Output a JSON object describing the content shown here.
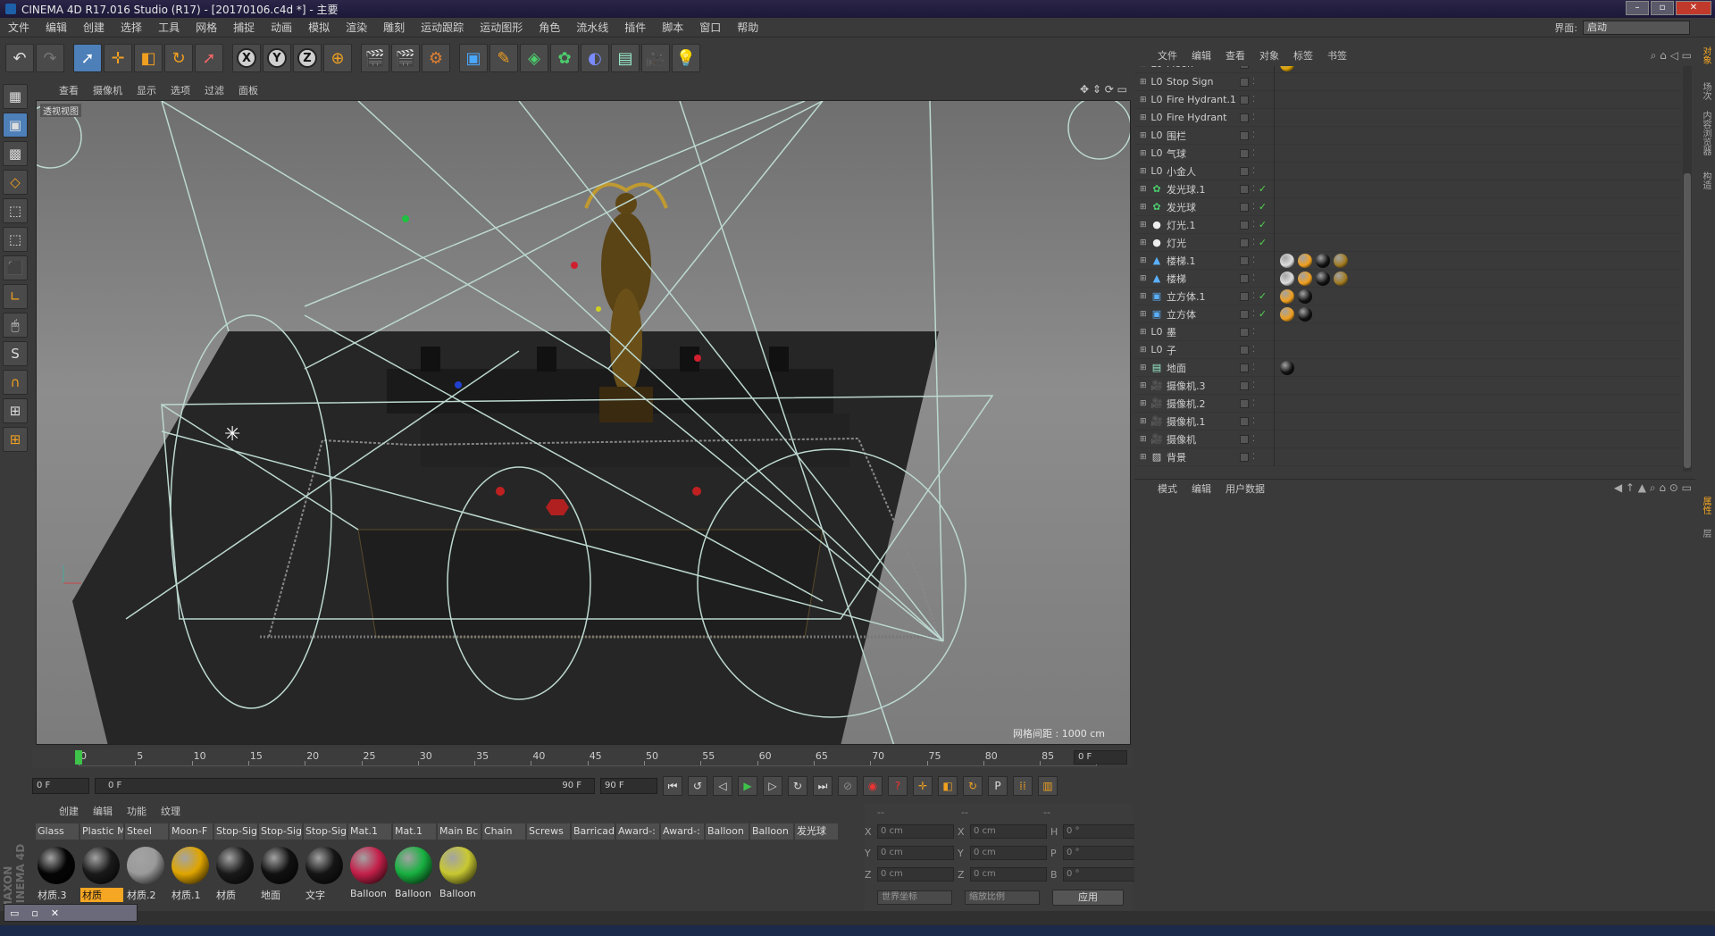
{
  "window": {
    "title": "CINEMA 4D R17.016 Studio (R17) - [20170106.c4d *] - 主要"
  },
  "menubar": [
    "文件",
    "编辑",
    "创建",
    "选择",
    "工具",
    "网格",
    "捕捉",
    "动画",
    "模拟",
    "渲染",
    "雕刻",
    "运动跟踪",
    "运动图形",
    "角色",
    "流水线",
    "插件",
    "脚本",
    "窗口",
    "帮助"
  ],
  "layout": {
    "label": "界面:",
    "value": "启动"
  },
  "toolbar": {
    "undo_icon": "undo-icon",
    "axis_x": "X",
    "axis_y": "Y",
    "axis_z": "Z"
  },
  "viewport": {
    "menu": [
      "查看",
      "摄像机",
      "显示",
      "选项",
      "过滤",
      "面板"
    ],
    "label": "透视视图",
    "grid_readout": "网格间距 : 1000 cm"
  },
  "timeline": {
    "ticks": [
      "0",
      "5",
      "10",
      "15",
      "20",
      "25",
      "30",
      "35",
      "40",
      "45",
      "50",
      "55",
      "60",
      "65",
      "70",
      "75",
      "80",
      "85",
      "90"
    ],
    "current_frame": "0 F",
    "start_field": "0 F",
    "range_start": "0 F",
    "range_end": "90 F",
    "end_field": "90 F"
  },
  "materials": {
    "menu": [
      "创建",
      "编辑",
      "功能",
      "纹理"
    ],
    "items": [
      {
        "name": "Glass",
        "label": "材质.3",
        "color": "#050505",
        "highlight": false
      },
      {
        "name": "Plastic M",
        "label": "材质",
        "color": "#1a1a1a",
        "highlight": true
      },
      {
        "name": "Steel",
        "label": "材质.2",
        "color": "#9a9a9a",
        "highlight": false
      },
      {
        "name": "Moon-F",
        "label": "材质.1",
        "color": "#e0a500",
        "highlight": false
      },
      {
        "name": "Stop-Sig",
        "label": "材质",
        "color": "#1a1a1a",
        "highlight": false
      },
      {
        "name": "Stop-Sig",
        "label": "地面",
        "color": "#111111",
        "highlight": false
      },
      {
        "name": "Stop-Sig",
        "label": "文字",
        "color": "#151515",
        "highlight": false
      },
      {
        "name": "Mat.1",
        "label": "Balloon",
        "color": "#c4204a",
        "highlight": false
      },
      {
        "name": "Mat.1",
        "label": "Balloon",
        "color": "#18b040",
        "highlight": false
      },
      {
        "name": "Main Bc",
        "label": "Balloon",
        "color": "#c8c832",
        "highlight": false
      },
      {
        "name": "Chain",
        "label": "",
        "color": "",
        "highlight": false
      },
      {
        "name": "Screws",
        "label": "",
        "color": "",
        "highlight": false
      },
      {
        "name": "Barricad",
        "label": "",
        "color": "",
        "highlight": false
      },
      {
        "name": "Award-:",
        "label": "",
        "color": "",
        "highlight": false
      },
      {
        "name": "Award-:",
        "label": "",
        "color": "",
        "highlight": false
      },
      {
        "name": "Balloon",
        "label": "",
        "color": "",
        "highlight": false
      },
      {
        "name": "Balloon",
        "label": "",
        "color": "",
        "highlight": false
      },
      {
        "name": "发光球",
        "label": "",
        "color": "",
        "highlight": false
      }
    ]
  },
  "coords": {
    "header": [
      "--",
      "--",
      "--"
    ],
    "rows": [
      {
        "a": "X",
        "av": "0 cm",
        "b": "X",
        "bv": "0 cm",
        "c": "H",
        "cv": "0 °"
      },
      {
        "a": "Y",
        "av": "0 cm",
        "b": "Y",
        "bv": "0 cm",
        "c": "P",
        "cv": "0 °"
      },
      {
        "a": "Z",
        "av": "0 cm",
        "b": "Z",
        "bv": "0 cm",
        "c": "B",
        "cv": "0 °"
      }
    ],
    "world": "世界坐标",
    "scale": "缩放比例",
    "apply": "应用"
  },
  "objects": {
    "menu": [
      "文件",
      "编辑",
      "查看",
      "对象",
      "标签",
      "书签"
    ],
    "rows": [
      {
        "name": "Moon",
        "icon": "null",
        "check": true
      },
      {
        "name": "Stop Sign",
        "icon": "null",
        "check": false
      },
      {
        "name": "Fire Hydrant.1",
        "icon": "null",
        "check": false
      },
      {
        "name": "Fire Hydrant",
        "icon": "null",
        "check": false
      },
      {
        "name": "围栏",
        "icon": "null",
        "check": false
      },
      {
        "name": "气球",
        "icon": "null",
        "check": false
      },
      {
        "name": "小金人",
        "icon": "null",
        "check": false
      },
      {
        "name": "发光球.1",
        "icon": "cloner",
        "check": true
      },
      {
        "name": "发光球",
        "icon": "cloner",
        "check": true
      },
      {
        "name": "灯光.1",
        "icon": "light",
        "check": true
      },
      {
        "name": "灯光",
        "icon": "light",
        "check": true
      },
      {
        "name": "楼梯.1",
        "icon": "stair",
        "check": false
      },
      {
        "name": "楼梯",
        "icon": "stair",
        "check": false
      },
      {
        "name": "立方体.1",
        "icon": "cube",
        "check": true
      },
      {
        "name": "立方体",
        "icon": "cube",
        "check": true
      },
      {
        "name": "墨",
        "icon": "null",
        "check": false
      },
      {
        "name": "子",
        "icon": "null",
        "check": false
      },
      {
        "name": "地面",
        "icon": "floor",
        "check": false
      },
      {
        "name": "摄像机.3",
        "icon": "camera",
        "check": false
      },
      {
        "name": "摄像机.2",
        "icon": "camera",
        "check": false
      },
      {
        "name": "摄像机.1",
        "icon": "camera",
        "check": false
      },
      {
        "name": "摄像机",
        "icon": "camera",
        "check": false
      },
      {
        "name": "背景",
        "icon": "background",
        "check": false
      }
    ]
  },
  "attributes": {
    "menu": [
      "模式",
      "编辑",
      "用户数据"
    ]
  },
  "right_tabs": [
    "对象",
    "场次",
    "内容浏览器",
    "构造",
    "属性",
    "层"
  ],
  "brand": "MAXON CINEMA 4D"
}
